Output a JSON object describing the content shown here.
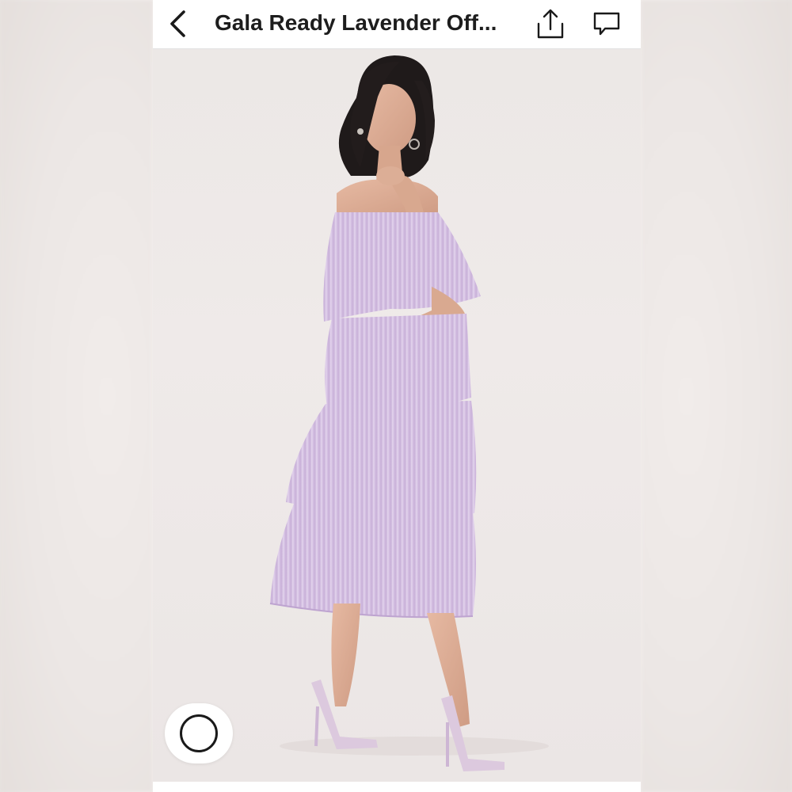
{
  "header": {
    "title": "Gala Ready Lavender Off...",
    "back_icon": "chevron-left-icon",
    "share_icon": "share-icon",
    "comment_icon": "comment-icon"
  },
  "photo": {
    "subject": "model in lavender off-the-shoulder tiered dress",
    "dress_color": "#d9c4e6",
    "background_color": "#ece8e6"
  },
  "overlay": {
    "circle_icon": "circle-select-icon"
  },
  "colors": {
    "bar_background": "#ffffff",
    "text": "#1d1d1d",
    "icon": "#1a1a1a"
  }
}
